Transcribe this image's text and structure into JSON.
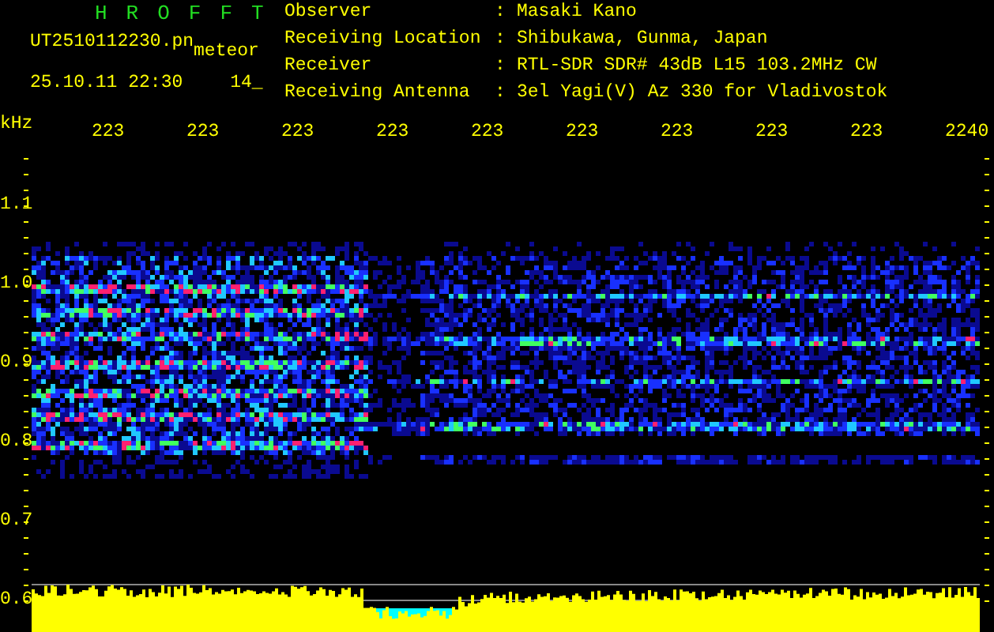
{
  "app_title": "HROFFT",
  "file_name": "UT2510112230.pn",
  "mode": "meteor",
  "date_time": "25.10.11 22:30",
  "count": "14_",
  "info": [
    {
      "label": "Observer",
      "separator": ":",
      "value": "Masaki Kano"
    },
    {
      "label": "Receiving Location",
      "separator": ":",
      "value": "Shibukawa, Gunma, Japan"
    },
    {
      "label": "Receiver",
      "separator": ":",
      "value": "RTL-SDR SDR# 43dB L15 103.2MHz CW"
    },
    {
      "label": "Receiving Antenna",
      "separator": ":",
      "value": "3el Yagi(V) Az 330 for Vladivostok"
    }
  ],
  "axis_unit": "kHz",
  "time_labels": [
    "223",
    "223",
    "223",
    "223",
    "223",
    "223",
    "223",
    "223",
    "223",
    "2240"
  ],
  "freq_labels": [
    "1.1",
    "1.0",
    "0.9",
    "0.8",
    "0.7",
    "0.6"
  ]
}
